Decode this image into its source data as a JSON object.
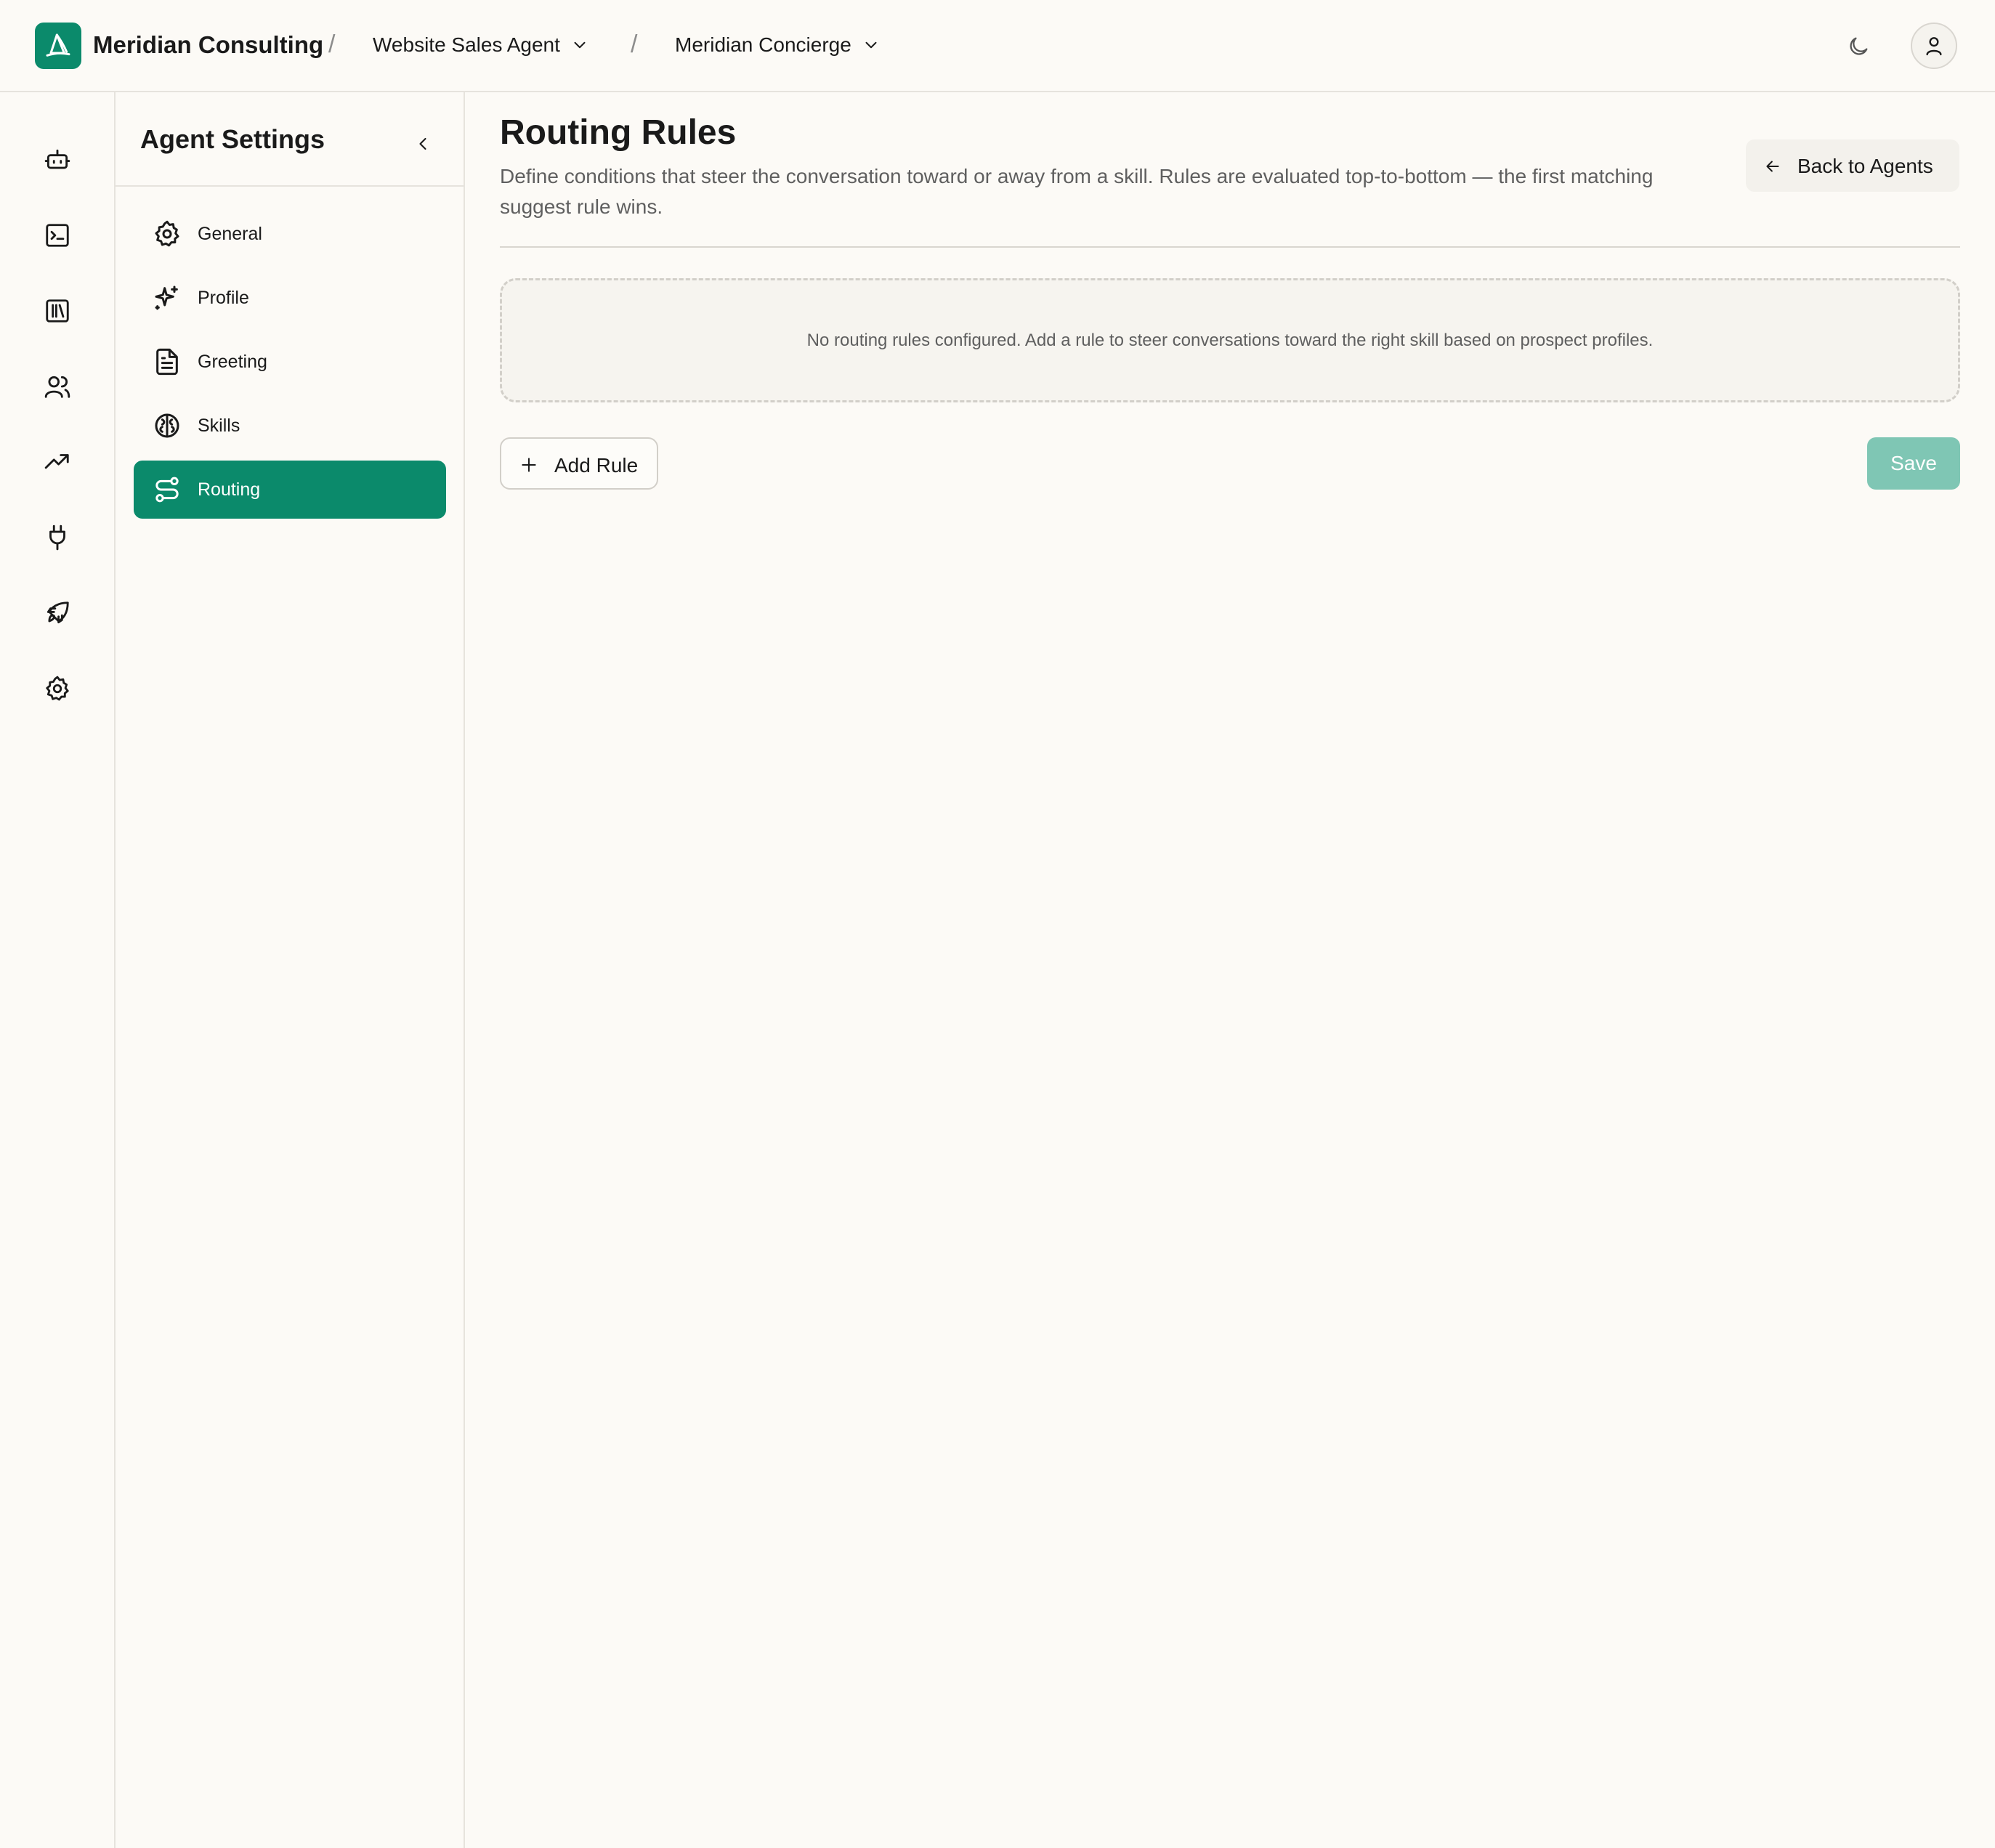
{
  "header": {
    "brand_name": "Meridian Consulting",
    "separator": "/",
    "agent_selector": "Website Sales Agent",
    "persona_selector": "Meridian Concierge",
    "brand_color": "#0b8a6b"
  },
  "rail": {
    "items": [
      {
        "icon": "bot-icon"
      },
      {
        "icon": "terminal-icon"
      },
      {
        "icon": "library-icon"
      },
      {
        "icon": "users-icon"
      },
      {
        "icon": "trending-up-icon"
      },
      {
        "icon": "plug-icon"
      },
      {
        "icon": "rocket-icon"
      },
      {
        "icon": "settings-icon"
      }
    ]
  },
  "settings": {
    "title": "Agent Settings",
    "items": [
      {
        "label": "General",
        "icon": "gear-icon"
      },
      {
        "label": "Profile",
        "icon": "sparkles-icon"
      },
      {
        "label": "Greeting",
        "icon": "file-text-icon"
      },
      {
        "label": "Skills",
        "icon": "brain-icon"
      },
      {
        "label": "Routing",
        "icon": "route-icon",
        "active": true
      }
    ]
  },
  "main": {
    "title": "Routing Rules",
    "description": "Define conditions that steer the conversation toward or away from a skill. Rules are evaluated top-to-bottom — the first matching suggest rule wins.",
    "back_label": "Back to Agents",
    "empty_message": "No routing rules configured. Add a rule to steer conversations toward the right skill based on prospect profiles.",
    "add_rule_label": "Add Rule",
    "save_label": "Save",
    "save_disabled_color": "#7fc6b4"
  }
}
